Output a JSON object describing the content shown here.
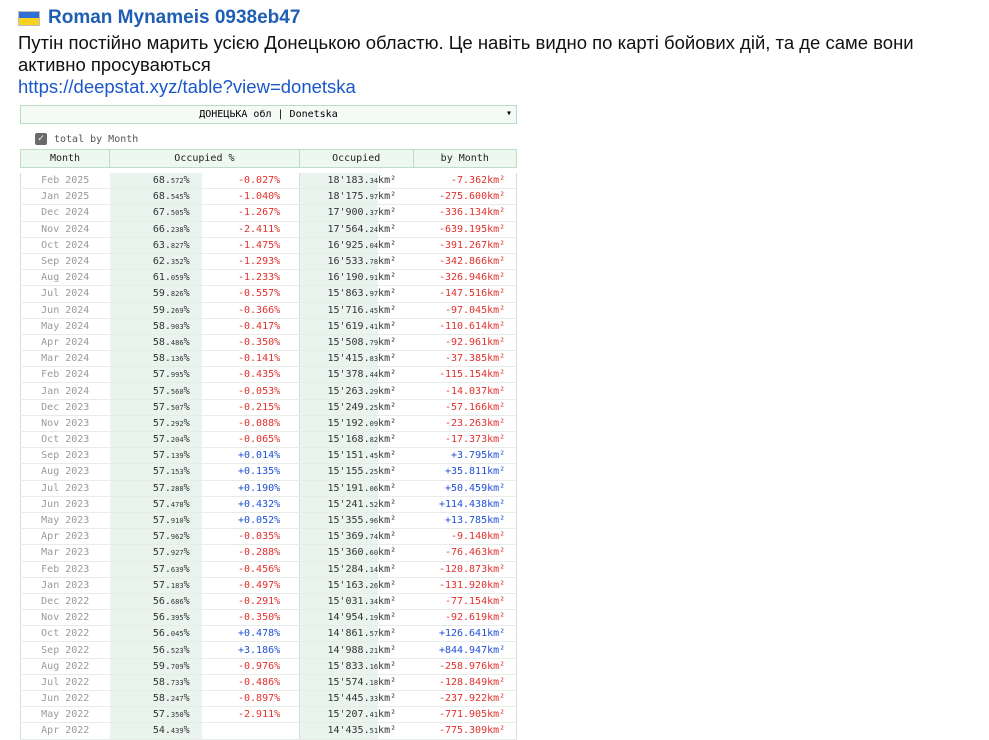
{
  "post": {
    "author": "Roman Mynameis 0938eb47",
    "flag_colors": [
      "#2f6fd6",
      "#f7d21e"
    ],
    "message": "Путін постійно марить усією Донецькою областю. Це навіть видно по карті бойових дій, та де саме вони активно просуваються",
    "link": "https://deepstat.xyz/table?view=donetska"
  },
  "widget": {
    "select_value": "ДОНЕЦЬКА обл | Donetska",
    "checkbox_label": "total by Month",
    "checkbox_checked": true,
    "headers": [
      "Month",
      "Occupied %",
      "Occupied",
      "by Month"
    ],
    "pct_unit": "%",
    "area_unit": "km²",
    "rows": [
      {
        "month": "Feb 2025",
        "pct": "68.572",
        "dpct": "-0.027",
        "area": "18'183.34",
        "darea": "-7.362"
      },
      {
        "month": "Jan 2025",
        "pct": "68.545",
        "dpct": "-1.040",
        "area": "18'175.97",
        "darea": "-275.600"
      },
      {
        "month": "Dec 2024",
        "pct": "67.505",
        "dpct": "-1.267",
        "area": "17'900.37",
        "darea": "-336.134"
      },
      {
        "month": "Nov 2024",
        "pct": "66.238",
        "dpct": "-2.411",
        "area": "17'564.24",
        "darea": "-639.195"
      },
      {
        "month": "Oct 2024",
        "pct": "63.827",
        "dpct": "-1.475",
        "area": "16'925.04",
        "darea": "-391.267"
      },
      {
        "month": "Sep 2024",
        "pct": "62.352",
        "dpct": "-1.293",
        "area": "16'533.78",
        "darea": "-342.866"
      },
      {
        "month": "Aug 2024",
        "pct": "61.059",
        "dpct": "-1.233",
        "area": "16'190.91",
        "darea": "-326.946"
      },
      {
        "month": "Jul 2024",
        "pct": "59.826",
        "dpct": "-0.557",
        "area": "15'863.97",
        "darea": "-147.516"
      },
      {
        "month": "Jun 2024",
        "pct": "59.269",
        "dpct": "-0.366",
        "area": "15'716.45",
        "darea": "-97.045"
      },
      {
        "month": "May 2024",
        "pct": "58.903",
        "dpct": "-0.417",
        "area": "15'619.41",
        "darea": "-110.614"
      },
      {
        "month": "Apr 2024",
        "pct": "58.486",
        "dpct": "-0.350",
        "area": "15'508.79",
        "darea": "-92.961"
      },
      {
        "month": "Mar 2024",
        "pct": "58.136",
        "dpct": "-0.141",
        "area": "15'415.83",
        "darea": "-37.385"
      },
      {
        "month": "Feb 2024",
        "pct": "57.995",
        "dpct": "-0.435",
        "area": "15'378.44",
        "darea": "-115.154"
      },
      {
        "month": "Jan 2024",
        "pct": "57.560",
        "dpct": "-0.053",
        "area": "15'263.29",
        "darea": "-14.037"
      },
      {
        "month": "Dec 2023",
        "pct": "57.507",
        "dpct": "-0.215",
        "area": "15'249.25",
        "darea": "-57.166"
      },
      {
        "month": "Nov 2023",
        "pct": "57.292",
        "dpct": "-0.088",
        "area": "15'192.09",
        "darea": "-23.263"
      },
      {
        "month": "Oct 2023",
        "pct": "57.204",
        "dpct": "-0.065",
        "area": "15'168.82",
        "darea": "-17.373"
      },
      {
        "month": "Sep 2023",
        "pct": "57.139",
        "dpct": "+0.014",
        "area": "15'151.45",
        "darea": "+3.795"
      },
      {
        "month": "Aug 2023",
        "pct": "57.153",
        "dpct": "+0.135",
        "area": "15'155.25",
        "darea": "+35.811"
      },
      {
        "month": "Jul 2023",
        "pct": "57.288",
        "dpct": "+0.190",
        "area": "15'191.06",
        "darea": "+50.459"
      },
      {
        "month": "Jun 2023",
        "pct": "57.478",
        "dpct": "+0.432",
        "area": "15'241.52",
        "darea": "+114.438"
      },
      {
        "month": "May 2023",
        "pct": "57.910",
        "dpct": "+0.052",
        "area": "15'355.96",
        "darea": "+13.785"
      },
      {
        "month": "Apr 2023",
        "pct": "57.962",
        "dpct": "-0.035",
        "area": "15'369.74",
        "darea": "-9.140"
      },
      {
        "month": "Mar 2023",
        "pct": "57.927",
        "dpct": "-0.288",
        "area": "15'360.60",
        "darea": "-76.463"
      },
      {
        "month": "Feb 2023",
        "pct": "57.639",
        "dpct": "-0.456",
        "area": "15'284.14",
        "darea": "-120.873"
      },
      {
        "month": "Jan 2023",
        "pct": "57.183",
        "dpct": "-0.497",
        "area": "15'163.26",
        "darea": "-131.920"
      },
      {
        "month": "Dec 2022",
        "pct": "56.686",
        "dpct": "-0.291",
        "area": "15'031.34",
        "darea": "-77.154"
      },
      {
        "month": "Nov 2022",
        "pct": "56.395",
        "dpct": "-0.350",
        "area": "14'954.19",
        "darea": "-92.619"
      },
      {
        "month": "Oct 2022",
        "pct": "56.045",
        "dpct": "+0.478",
        "area": "14'861.57",
        "darea": "+126.641"
      },
      {
        "month": "Sep 2022",
        "pct": "56.523",
        "dpct": "+3.186",
        "area": "14'988.21",
        "darea": "+844.947"
      },
      {
        "month": "Aug 2022",
        "pct": "59.709",
        "dpct": "-0.976",
        "area": "15'833.16",
        "darea": "-258.976"
      },
      {
        "month": "Jul 2022",
        "pct": "58.733",
        "dpct": "-0.486",
        "area": "15'574.18",
        "darea": "-128.849"
      },
      {
        "month": "Jun 2022",
        "pct": "58.247",
        "dpct": "-0.897",
        "area": "15'445.33",
        "darea": "-237.922"
      },
      {
        "month": "May 2022",
        "pct": "57.350",
        "dpct": "-2.911",
        "area": "15'207.41",
        "darea": "-771.905"
      },
      {
        "month": "Apr 2022",
        "pct": "54.439",
        "dpct": "",
        "area": "14'435.51",
        "darea": "-775.309"
      }
    ]
  }
}
